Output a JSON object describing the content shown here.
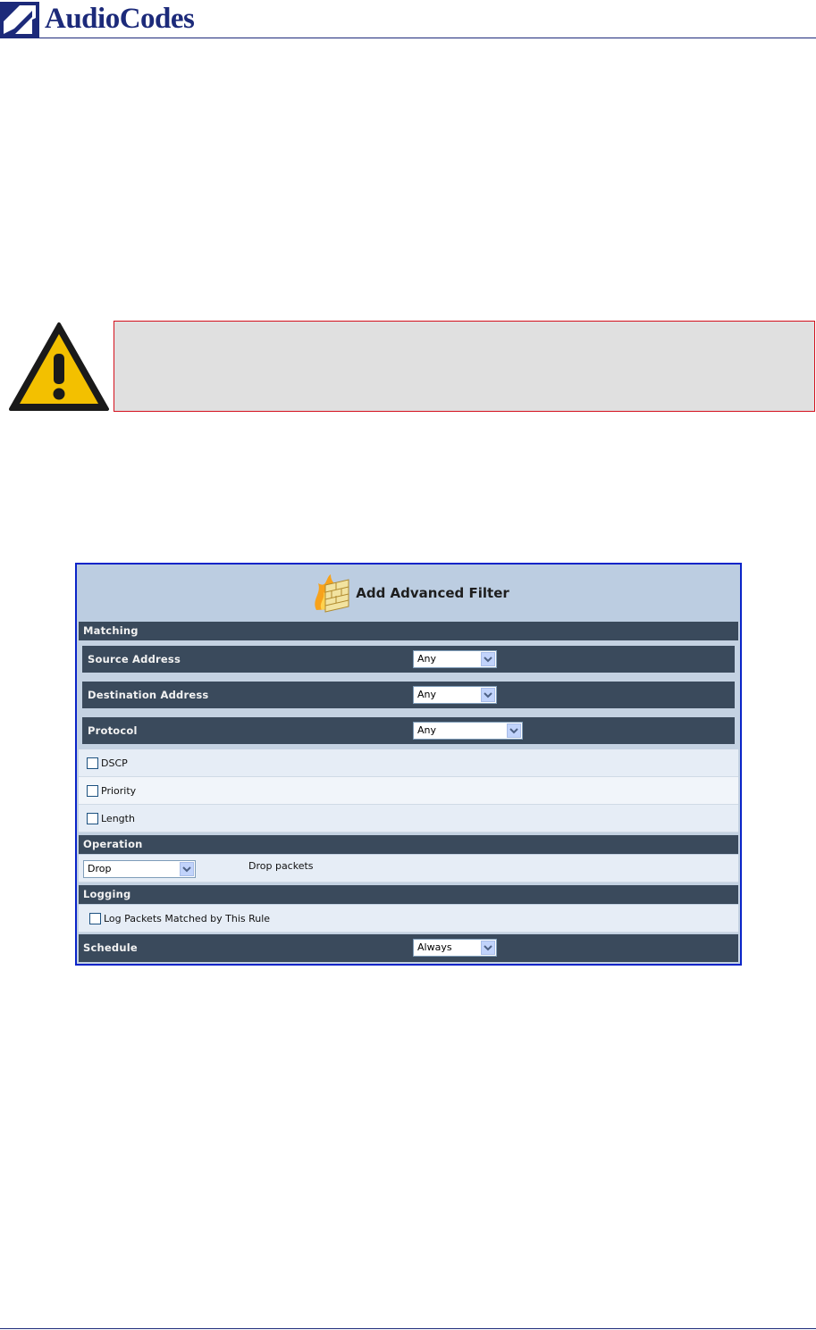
{
  "header": {
    "brand": "AudioCodes"
  },
  "dialog": {
    "title": "Add Advanced Filter",
    "sections": {
      "matching": "Matching",
      "operation": "Operation",
      "logging": "Logging",
      "schedule": "Schedule"
    },
    "fields": {
      "source_address": {
        "label": "Source Address",
        "value": "Any"
      },
      "destination_address": {
        "label": "Destination Address",
        "value": "Any"
      },
      "protocol": {
        "label": "Protocol",
        "value": "Any"
      }
    },
    "checkboxes": {
      "dscp": "DSCP",
      "priority": "Priority",
      "length": "Length",
      "log_packets": "Log Packets Matched by This Rule"
    },
    "operation": {
      "value": "Drop",
      "description": "Drop packets"
    },
    "schedule": {
      "value": "Always"
    }
  }
}
